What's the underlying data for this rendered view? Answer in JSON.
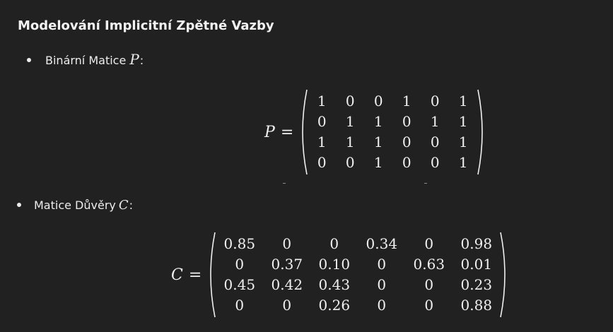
{
  "heading": "Modelování Implicitní Zpětné Vazby",
  "bullets": [
    {
      "label": "Binární Matice",
      "var": "P",
      "colon": ":"
    },
    {
      "label": "Matice Důvěry",
      "var": "C",
      "colon": ":"
    }
  ],
  "equations": {
    "P": {
      "lhs": "P",
      "eq": "=",
      "rows": [
        [
          "1",
          "0",
          "0",
          "1",
          "0",
          "1"
        ],
        [
          "0",
          "1",
          "1",
          "0",
          "1",
          "1"
        ],
        [
          "1",
          "1",
          "1",
          "0",
          "0",
          "1"
        ],
        [
          "0",
          "0",
          "1",
          "0",
          "0",
          "1"
        ]
      ]
    },
    "C": {
      "lhs": "C",
      "eq": "=",
      "rows": [
        [
          "0.85",
          "0",
          "0",
          "0.34",
          "0",
          "0.98"
        ],
        [
          "0",
          "0.37",
          "0.10",
          "0",
          "0.63",
          "0.01"
        ],
        [
          "0.45",
          "0.42",
          "0.43",
          "0",
          "0",
          "0.23"
        ],
        [
          "0",
          "0",
          "0.26",
          "0",
          "0",
          "0.88"
        ]
      ]
    }
  }
}
